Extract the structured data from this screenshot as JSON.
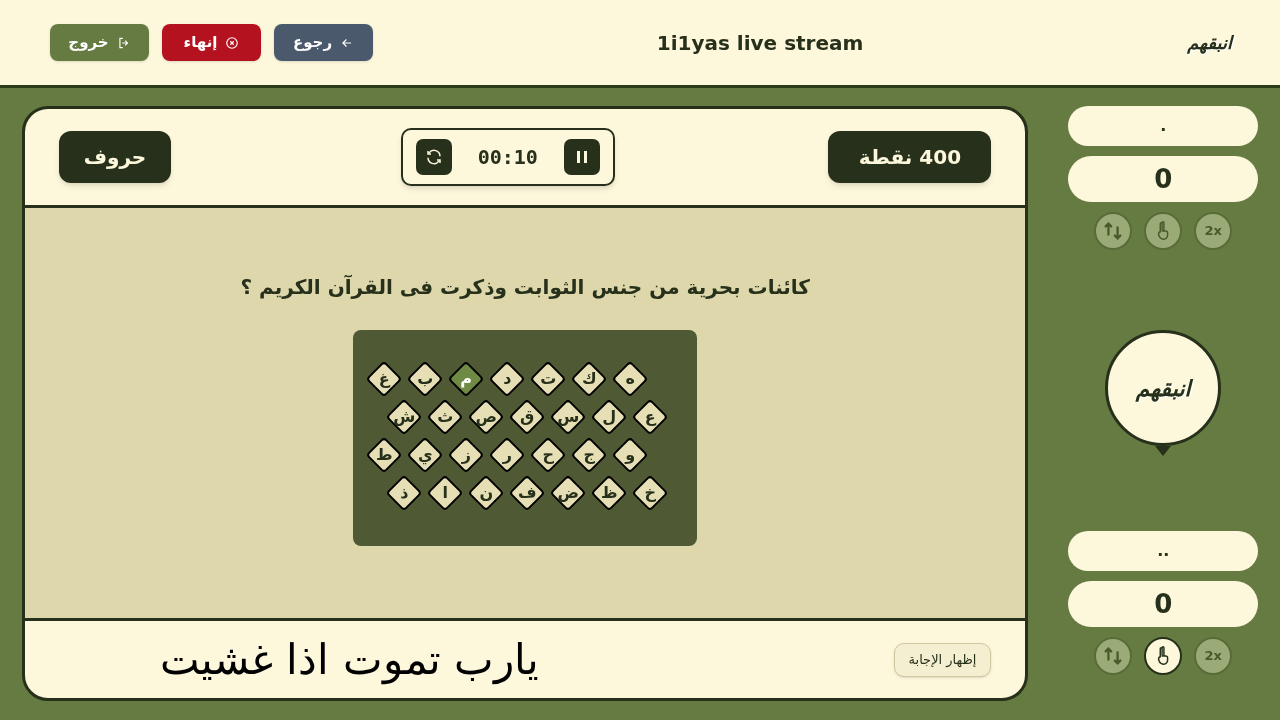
{
  "header": {
    "buttons": [
      {
        "kind": "back",
        "label": "رجوع"
      },
      {
        "kind": "end",
        "label": "إنهاء"
      },
      {
        "kind": "exit",
        "label": "خروج"
      }
    ],
    "title": "1i1yas live stream",
    "logo": "انبقهم"
  },
  "game": {
    "category": "حروف",
    "timer": "00:10",
    "points": "400 نقطة",
    "question": "كائنات بحرية من جنس الثوابت وذكرت فى القرآن الكريم ؟",
    "board": [
      [
        {
          "letter": "ه",
          "selected": false
        },
        {
          "letter": "ك",
          "selected": false
        },
        {
          "letter": "ت",
          "selected": false
        },
        {
          "letter": "د",
          "selected": false
        },
        {
          "letter": "م",
          "selected": true
        },
        {
          "letter": "ب",
          "selected": false
        },
        {
          "letter": "غ",
          "selected": false
        }
      ],
      [
        {
          "letter": "ع",
          "selected": false
        },
        {
          "letter": "ل",
          "selected": false
        },
        {
          "letter": "س",
          "selected": false
        },
        {
          "letter": "ق",
          "selected": false
        },
        {
          "letter": "ص",
          "selected": false
        },
        {
          "letter": "ث",
          "selected": false
        },
        {
          "letter": "ش",
          "selected": false
        }
      ],
      [
        {
          "letter": "و",
          "selected": false
        },
        {
          "letter": "ج",
          "selected": false
        },
        {
          "letter": "ح",
          "selected": false
        },
        {
          "letter": "ر",
          "selected": false
        },
        {
          "letter": "ز",
          "selected": false
        },
        {
          "letter": "ي",
          "selected": false
        },
        {
          "letter": "ط",
          "selected": false
        }
      ],
      [
        {
          "letter": "خ",
          "selected": false
        },
        {
          "letter": "ظ",
          "selected": false
        },
        {
          "letter": "ض",
          "selected": false
        },
        {
          "letter": "ف",
          "selected": false
        },
        {
          "letter": "ن",
          "selected": false
        },
        {
          "letter": "ا",
          "selected": false
        },
        {
          "letter": "ذ",
          "selected": false
        }
      ]
    ],
    "answer": "يارب تموت اذا غشيت",
    "show_answer_button": "إظهار الإجابة"
  },
  "teams": [
    {
      "name": ".",
      "score": "0",
      "powerups": [
        {
          "kind": "swap",
          "active": false
        },
        {
          "kind": "hand",
          "active": false
        },
        {
          "kind": "double",
          "label": "2x",
          "active": false
        }
      ]
    },
    {
      "name": "..",
      "score": "0",
      "powerups": [
        {
          "kind": "swap",
          "active": false
        },
        {
          "kind": "hand",
          "active": true
        },
        {
          "kind": "double",
          "label": "2x",
          "active": false
        }
      ]
    }
  ],
  "turn_badge": {
    "logo": "انبقهم"
  }
}
